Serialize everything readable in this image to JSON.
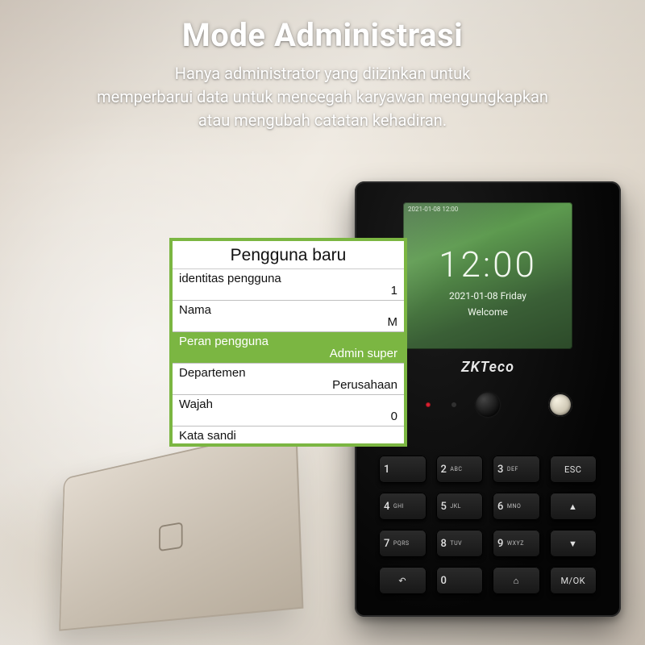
{
  "heading": {
    "title": "Mode Administrasi",
    "line1": "Hanya administrator yang diizinkan untuk",
    "line2": "memperbarui data untuk mencegah karyawan mengungkapkan",
    "line3": "atau mengubah catatan kehadiran."
  },
  "device": {
    "brand": "ZKTeco",
    "screen": {
      "timestamp": "2021-01-08 12:00",
      "time": "12:00",
      "date": "2021-01-08  Friday",
      "welcome": "Welcome"
    },
    "keys": {
      "k1n": "1",
      "k1a": "",
      "k2n": "2",
      "k2a": "ABC",
      "k3n": "3",
      "k3a": "DEF",
      "kesc": "ESC",
      "k4n": "4",
      "k4a": "GHI",
      "k5n": "5",
      "k5a": "JKL",
      "k6n": "6",
      "k6a": "MNO",
      "kup": "▲",
      "k7n": "7",
      "k7a": "PQRS",
      "k8n": "8",
      "k8a": "TUV",
      "k9n": "9",
      "k9a": "WXYZ",
      "kdn": "▼",
      "kback": "↶",
      "k0n": "0",
      "k0a": "",
      "kdoor": "⌂",
      "kok": "M/OK"
    }
  },
  "popup": {
    "title": "Pengguna baru",
    "rows": [
      {
        "label": "identitas pengguna",
        "value": "1",
        "selected": false
      },
      {
        "label": "Nama",
        "value": "M",
        "selected": false
      },
      {
        "label": "Peran pengguna",
        "value": "Admin super",
        "selected": true
      },
      {
        "label": "Departemen",
        "value": "Perusahaan",
        "selected": false
      },
      {
        "label": "Wajah",
        "value": "0",
        "selected": false
      },
      {
        "label": "Kata sandi",
        "value": "",
        "selected": false
      }
    ]
  }
}
